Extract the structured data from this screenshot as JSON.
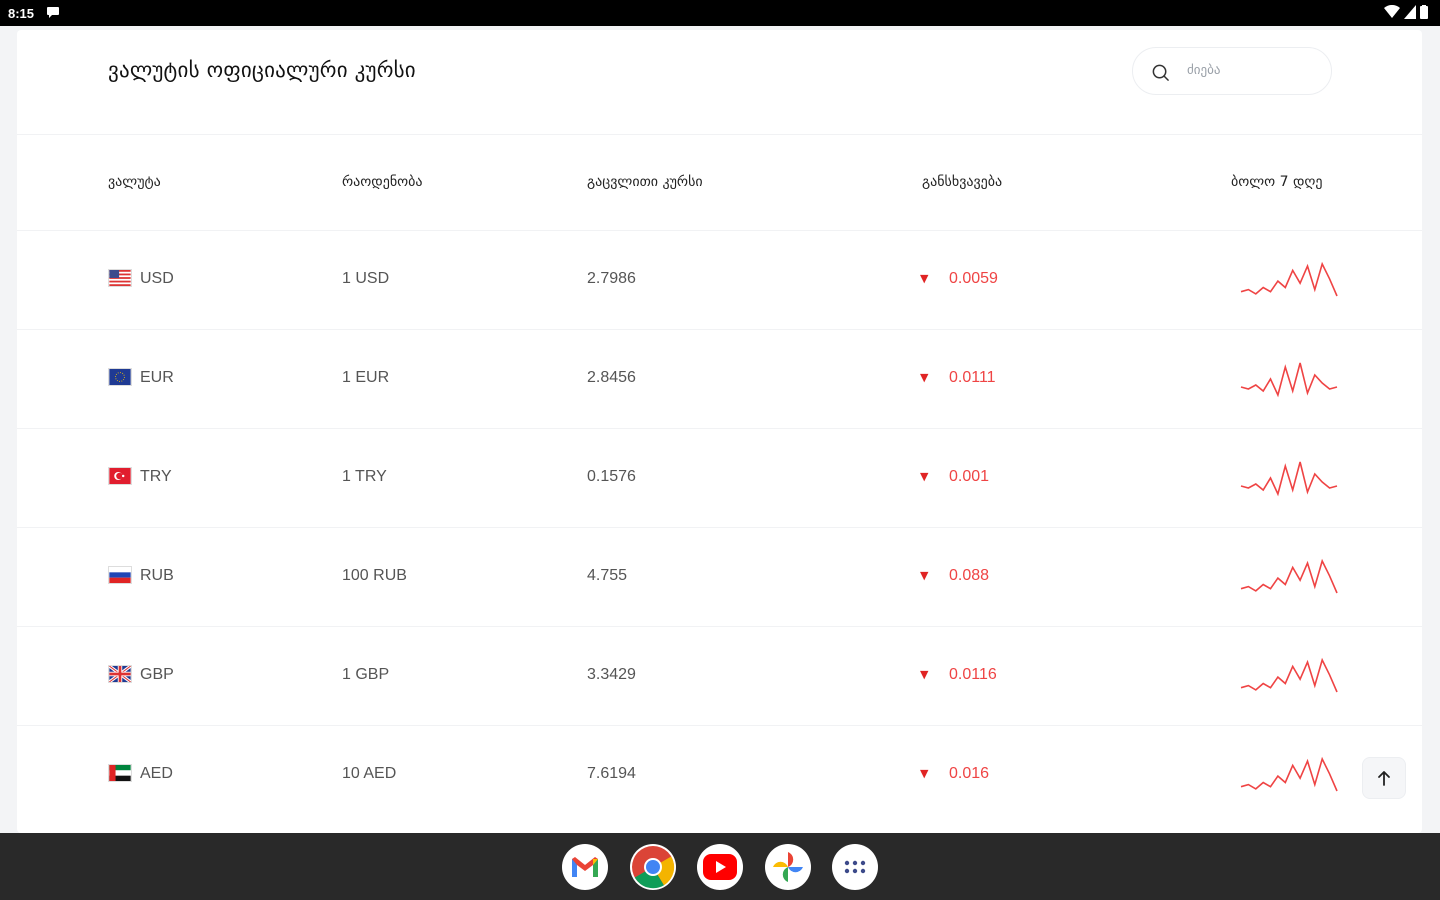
{
  "status_bar": {
    "time": "8:15"
  },
  "header": {
    "title": "ვალუტის ოფიციალური კურსი"
  },
  "search": {
    "placeholder": "ძიება"
  },
  "columns": [
    "ვალუტა",
    "რაოდენობა",
    "გაცვლითი კურსი",
    "განსხვავება",
    "ბოლო 7 დღე"
  ],
  "rows": [
    {
      "code": "USD",
      "quantity": "1 USD",
      "rate": "2.7986",
      "difference": "0.0059",
      "trend": "down",
      "sparkline": [
        4,
        5,
        3,
        6,
        4,
        9,
        6,
        14,
        8,
        16,
        5,
        17,
        10,
        2
      ]
    },
    {
      "code": "EUR",
      "quantity": "1 EUR",
      "rate": "2.8456",
      "difference": "0.0111",
      "trend": "down",
      "sparkline": [
        6,
        5,
        7,
        4,
        10,
        2,
        16,
        4,
        18,
        3,
        12,
        8,
        5,
        6
      ]
    },
    {
      "code": "TRY",
      "quantity": "1 TRY",
      "rate": "0.1576",
      "difference": "0.001",
      "trend": "down",
      "sparkline": [
        6,
        5,
        7,
        4,
        10,
        2,
        16,
        4,
        18,
        3,
        12,
        8,
        5,
        6
      ]
    },
    {
      "code": "RUB",
      "quantity": "100 RUB",
      "rate": "4.755",
      "difference": "0.088",
      "trend": "down",
      "sparkline": [
        4,
        5,
        3,
        6,
        4,
        9,
        6,
        14,
        8,
        16,
        5,
        17,
        10,
        2
      ]
    },
    {
      "code": "GBP",
      "quantity": "1 GBP",
      "rate": "3.3429",
      "difference": "0.0116",
      "trend": "down",
      "sparkline": [
        4,
        5,
        3,
        6,
        4,
        9,
        6,
        14,
        8,
        16,
        5,
        17,
        10,
        2
      ]
    },
    {
      "code": "AED",
      "quantity": "10 AED",
      "rate": "7.6194",
      "difference": "0.016",
      "trend": "down",
      "sparkline": [
        4,
        5,
        3,
        6,
        4,
        9,
        6,
        14,
        8,
        16,
        5,
        17,
        10,
        2
      ]
    }
  ],
  "colors": {
    "negative": "#ef4444",
    "title": "#111111"
  },
  "icons": {
    "trend_down": "▼",
    "search": "search-icon",
    "scroll_top": "arrow-up-icon"
  },
  "taskbar": {
    "apps": [
      "gmail-icon",
      "chrome-icon",
      "youtube-icon",
      "photos-icon",
      "app-launcher-icon"
    ]
  }
}
